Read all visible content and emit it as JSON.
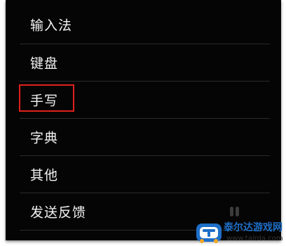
{
  "menu": {
    "items": [
      {
        "label": "输入法"
      },
      {
        "label": "键盘"
      },
      {
        "label": "手写",
        "highlighted": true
      },
      {
        "label": "字典"
      },
      {
        "label": "其他"
      },
      {
        "label": "发送反馈"
      }
    ]
  },
  "colors": {
    "panel_background": "#050505",
    "text": "#f2f2f2",
    "divider": "#2a2a2a",
    "highlight_border": "#e0201c",
    "watermark_blue": "#1e6fc8"
  },
  "watermark": {
    "site_name": "泰尔达游戏网",
    "url": "www.tairda.com",
    "logo_icon": "tairda-logo-icon"
  }
}
